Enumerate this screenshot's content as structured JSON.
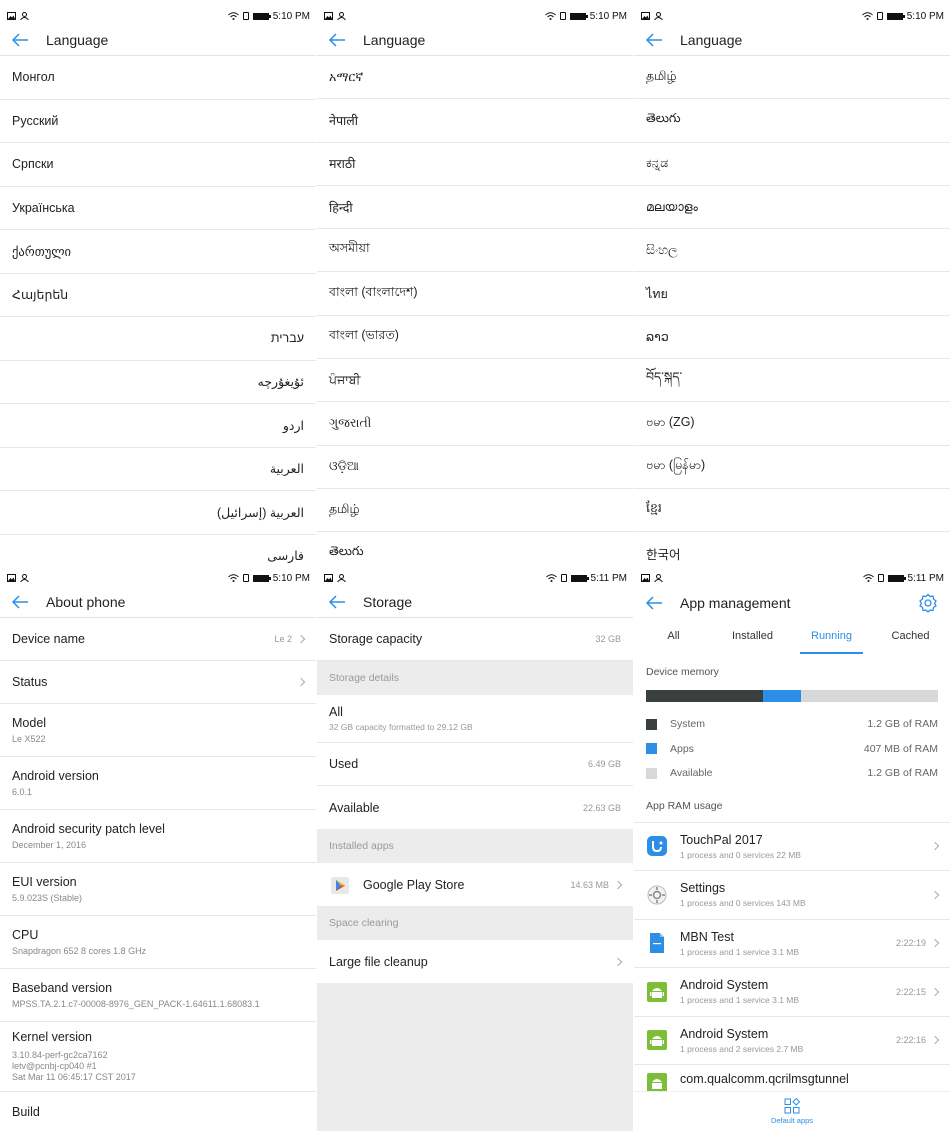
{
  "status": {
    "time_a": "5:10 PM",
    "time_b": "5:11 PM"
  },
  "colors": {
    "accent": "#2b8fe6",
    "system_mem": "#3a3f40",
    "apps_mem": "#2d8ee6",
    "available_mem": "#d7d9d9"
  },
  "panel1": {
    "title": "Language",
    "items": [
      "Монгол",
      "Русский",
      "Српски",
      "Українська",
      "ქართული",
      "Հայերեն",
      "עברית",
      "ئۇيغۇرچە",
      "اردو",
      "العربية",
      "العربية (إسرائيل)",
      "فارسی"
    ]
  },
  "panel2": {
    "title": "Language",
    "items": [
      "አማርኛ",
      "नेपाली",
      "मराठी",
      "हिन्दी",
      "অসমীয়া",
      "বাংলা (বাংলাদেশ)",
      "বাংলা (ভারত)",
      "ਪੰਜਾਬੀ",
      "ગુજરાતી",
      "ଓଡ଼ିଆ",
      "தமிழ்",
      "తెలుగు"
    ]
  },
  "panel3": {
    "title": "Language",
    "items": [
      "தமிழ்",
      "తెలుగు",
      "ಕನ್ನಡ",
      "മലയാളം",
      "සිංහල",
      "ไทย",
      "ລາວ",
      "བོད་སྐད་",
      "ဗမာ (ZG)",
      "ဗမာ (မြန်မာ)",
      "ខ្មែរ",
      "한국어"
    ]
  },
  "about": {
    "title": "About phone",
    "device_name_label": "Device name",
    "device_name_value": "Le 2",
    "status_label": "Status",
    "model_label": "Model",
    "model_value": "Le X522",
    "android_label": "Android version",
    "android_value": "6.0.1",
    "patch_label": "Android security patch level",
    "patch_value": "December 1, 2016",
    "eui_label": "EUI version",
    "eui_value": "5.9.023S (Stable)",
    "cpu_label": "CPU",
    "cpu_value": "Snapdragon 652 8 cores 1.8 GHz",
    "baseband_label": "Baseband version",
    "baseband_value": "MPSS.TA.2.1.c7-00008-8976_GEN_PACK-1.64611.1.68083.1",
    "kernel_label": "Kernel version",
    "kernel_line1": "3.10.84-perf-gc2ca7162",
    "kernel_line2": "letv@pcnbj-cp040 #1",
    "kernel_line3": "Sat Mar 11 06:45:17 CST 2017",
    "build_label": "Build"
  },
  "storage": {
    "title": "Storage",
    "capacity_label": "Storage capacity",
    "capacity_value": "32 GB",
    "details_header": "Storage details",
    "all_label": "All",
    "all_sub": "32 GB capacity formatted to 29.12 GB",
    "used_label": "Used",
    "used_value": "6.49 GB",
    "available_label": "Available",
    "available_value": "22.63 GB",
    "installed_header": "Installed apps",
    "play_label": "Google Play Store",
    "play_value": "14.63 MB",
    "clearing_header": "Space clearing",
    "cleanup_label": "Large file cleanup"
  },
  "apps": {
    "title": "App management",
    "tabs": [
      "All",
      "Installed",
      "Running",
      "Cached"
    ],
    "device_memory_label": "Device memory",
    "memory_fractions": {
      "system": 0.4,
      "apps": 0.13
    },
    "legend": [
      {
        "name": "System",
        "value": "1.2 GB of RAM"
      },
      {
        "name": "Apps",
        "value": "407 MB of RAM"
      },
      {
        "name": "Available",
        "value": "1.2 GB of RAM"
      }
    ],
    "ram_usage_label": "App RAM usage",
    "list": [
      {
        "name": "TouchPal 2017",
        "meta": "1 process and 0 services   22 MB",
        "time": ""
      },
      {
        "name": "Settings",
        "meta": "1 process and 0 services   143 MB",
        "time": ""
      },
      {
        "name": "MBN Test",
        "meta": "1 process and 1 service   3.1 MB",
        "time": "2:22:19"
      },
      {
        "name": "Android System",
        "meta": "1 process and 1 service   3.1 MB",
        "time": "2:22:15"
      },
      {
        "name": "Android System",
        "meta": "1 process and 2 services   2.7 MB",
        "time": "2:22:16"
      },
      {
        "name": "com.qualcomm.qcrilmsgtunnel",
        "meta": "",
        "time": ""
      }
    ],
    "bottom_label": "Default apps"
  }
}
